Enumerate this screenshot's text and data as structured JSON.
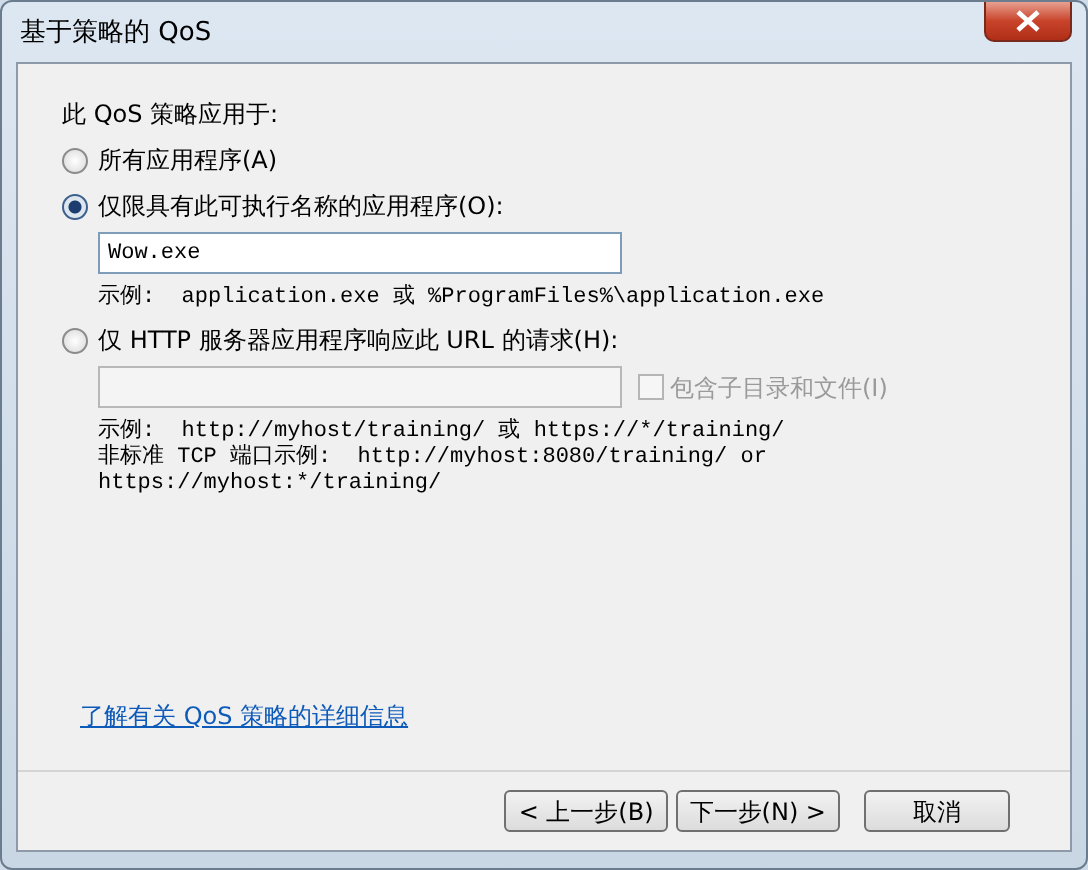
{
  "window": {
    "title": "基于策略的 QoS"
  },
  "prompt": "此 QoS 策略应用于:",
  "options": [
    {
      "label": "所有应用程序(A)",
      "selected": false
    },
    {
      "label": "仅限具有此可执行名称的应用程序(O):",
      "selected": true,
      "field": {
        "value": "Wow.exe",
        "disabled": false
      },
      "examples": [
        "示例:  application.exe 或 %ProgramFiles%\\application.exe"
      ]
    },
    {
      "label": "仅 HTTP 服务器应用程序响应此 URL 的请求(H):",
      "selected": false,
      "field": {
        "disabled": true
      },
      "checkbox": {
        "label": "包含子目录和文件(I)",
        "checked": false,
        "disabled": true
      },
      "examples": [
        "示例:  http://myhost/training/ 或 https://*/training/",
        "非标准 TCP 端口示例:  http://myhost:8080/training/ or",
        "https://myhost:*/training/"
      ]
    }
  ],
  "link": "了解有关 QoS 策略的详细信息",
  "buttons": [
    {
      "label": "< 上一步(B)"
    },
    {
      "label": "下一步(N) >"
    },
    {
      "label": "取消"
    }
  ]
}
